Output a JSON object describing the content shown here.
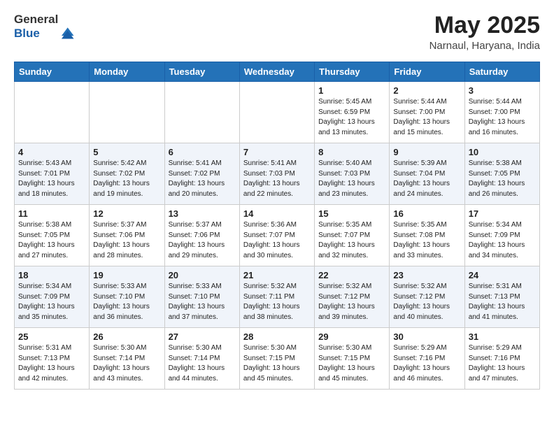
{
  "logo": {
    "general": "General",
    "blue": "Blue"
  },
  "header": {
    "month": "May 2025",
    "location": "Narnaul, Haryana, India"
  },
  "weekdays": [
    "Sunday",
    "Monday",
    "Tuesday",
    "Wednesday",
    "Thursday",
    "Friday",
    "Saturday"
  ],
  "weeks": [
    [
      {
        "day": "",
        "sunrise": "",
        "sunset": "",
        "daylight": ""
      },
      {
        "day": "",
        "sunrise": "",
        "sunset": "",
        "daylight": ""
      },
      {
        "day": "",
        "sunrise": "",
        "sunset": "",
        "daylight": ""
      },
      {
        "day": "",
        "sunrise": "",
        "sunset": "",
        "daylight": ""
      },
      {
        "day": "1",
        "sunrise": "Sunrise: 5:45 AM",
        "sunset": "Sunset: 6:59 PM",
        "daylight": "Daylight: 13 hours and 13 minutes."
      },
      {
        "day": "2",
        "sunrise": "Sunrise: 5:44 AM",
        "sunset": "Sunset: 7:00 PM",
        "daylight": "Daylight: 13 hours and 15 minutes."
      },
      {
        "day": "3",
        "sunrise": "Sunrise: 5:44 AM",
        "sunset": "Sunset: 7:00 PM",
        "daylight": "Daylight: 13 hours and 16 minutes."
      }
    ],
    [
      {
        "day": "4",
        "sunrise": "Sunrise: 5:43 AM",
        "sunset": "Sunset: 7:01 PM",
        "daylight": "Daylight: 13 hours and 18 minutes."
      },
      {
        "day": "5",
        "sunrise": "Sunrise: 5:42 AM",
        "sunset": "Sunset: 7:02 PM",
        "daylight": "Daylight: 13 hours and 19 minutes."
      },
      {
        "day": "6",
        "sunrise": "Sunrise: 5:41 AM",
        "sunset": "Sunset: 7:02 PM",
        "daylight": "Daylight: 13 hours and 20 minutes."
      },
      {
        "day": "7",
        "sunrise": "Sunrise: 5:41 AM",
        "sunset": "Sunset: 7:03 PM",
        "daylight": "Daylight: 13 hours and 22 minutes."
      },
      {
        "day": "8",
        "sunrise": "Sunrise: 5:40 AM",
        "sunset": "Sunset: 7:03 PM",
        "daylight": "Daylight: 13 hours and 23 minutes."
      },
      {
        "day": "9",
        "sunrise": "Sunrise: 5:39 AM",
        "sunset": "Sunset: 7:04 PM",
        "daylight": "Daylight: 13 hours and 24 minutes."
      },
      {
        "day": "10",
        "sunrise": "Sunrise: 5:38 AM",
        "sunset": "Sunset: 7:05 PM",
        "daylight": "Daylight: 13 hours and 26 minutes."
      }
    ],
    [
      {
        "day": "11",
        "sunrise": "Sunrise: 5:38 AM",
        "sunset": "Sunset: 7:05 PM",
        "daylight": "Daylight: 13 hours and 27 minutes."
      },
      {
        "day": "12",
        "sunrise": "Sunrise: 5:37 AM",
        "sunset": "Sunset: 7:06 PM",
        "daylight": "Daylight: 13 hours and 28 minutes."
      },
      {
        "day": "13",
        "sunrise": "Sunrise: 5:37 AM",
        "sunset": "Sunset: 7:06 PM",
        "daylight": "Daylight: 13 hours and 29 minutes."
      },
      {
        "day": "14",
        "sunrise": "Sunrise: 5:36 AM",
        "sunset": "Sunset: 7:07 PM",
        "daylight": "Daylight: 13 hours and 30 minutes."
      },
      {
        "day": "15",
        "sunrise": "Sunrise: 5:35 AM",
        "sunset": "Sunset: 7:07 PM",
        "daylight": "Daylight: 13 hours and 32 minutes."
      },
      {
        "day": "16",
        "sunrise": "Sunrise: 5:35 AM",
        "sunset": "Sunset: 7:08 PM",
        "daylight": "Daylight: 13 hours and 33 minutes."
      },
      {
        "day": "17",
        "sunrise": "Sunrise: 5:34 AM",
        "sunset": "Sunset: 7:09 PM",
        "daylight": "Daylight: 13 hours and 34 minutes."
      }
    ],
    [
      {
        "day": "18",
        "sunrise": "Sunrise: 5:34 AM",
        "sunset": "Sunset: 7:09 PM",
        "daylight": "Daylight: 13 hours and 35 minutes."
      },
      {
        "day": "19",
        "sunrise": "Sunrise: 5:33 AM",
        "sunset": "Sunset: 7:10 PM",
        "daylight": "Daylight: 13 hours and 36 minutes."
      },
      {
        "day": "20",
        "sunrise": "Sunrise: 5:33 AM",
        "sunset": "Sunset: 7:10 PM",
        "daylight": "Daylight: 13 hours and 37 minutes."
      },
      {
        "day": "21",
        "sunrise": "Sunrise: 5:32 AM",
        "sunset": "Sunset: 7:11 PM",
        "daylight": "Daylight: 13 hours and 38 minutes."
      },
      {
        "day": "22",
        "sunrise": "Sunrise: 5:32 AM",
        "sunset": "Sunset: 7:12 PM",
        "daylight": "Daylight: 13 hours and 39 minutes."
      },
      {
        "day": "23",
        "sunrise": "Sunrise: 5:32 AM",
        "sunset": "Sunset: 7:12 PM",
        "daylight": "Daylight: 13 hours and 40 minutes."
      },
      {
        "day": "24",
        "sunrise": "Sunrise: 5:31 AM",
        "sunset": "Sunset: 7:13 PM",
        "daylight": "Daylight: 13 hours and 41 minutes."
      }
    ],
    [
      {
        "day": "25",
        "sunrise": "Sunrise: 5:31 AM",
        "sunset": "Sunset: 7:13 PM",
        "daylight": "Daylight: 13 hours and 42 minutes."
      },
      {
        "day": "26",
        "sunrise": "Sunrise: 5:30 AM",
        "sunset": "Sunset: 7:14 PM",
        "daylight": "Daylight: 13 hours and 43 minutes."
      },
      {
        "day": "27",
        "sunrise": "Sunrise: 5:30 AM",
        "sunset": "Sunset: 7:14 PM",
        "daylight": "Daylight: 13 hours and 44 minutes."
      },
      {
        "day": "28",
        "sunrise": "Sunrise: 5:30 AM",
        "sunset": "Sunset: 7:15 PM",
        "daylight": "Daylight: 13 hours and 45 minutes."
      },
      {
        "day": "29",
        "sunrise": "Sunrise: 5:30 AM",
        "sunset": "Sunset: 7:15 PM",
        "daylight": "Daylight: 13 hours and 45 minutes."
      },
      {
        "day": "30",
        "sunrise": "Sunrise: 5:29 AM",
        "sunset": "Sunset: 7:16 PM",
        "daylight": "Daylight: 13 hours and 46 minutes."
      },
      {
        "day": "31",
        "sunrise": "Sunrise: 5:29 AM",
        "sunset": "Sunset: 7:16 PM",
        "daylight": "Daylight: 13 hours and 47 minutes."
      }
    ]
  ]
}
